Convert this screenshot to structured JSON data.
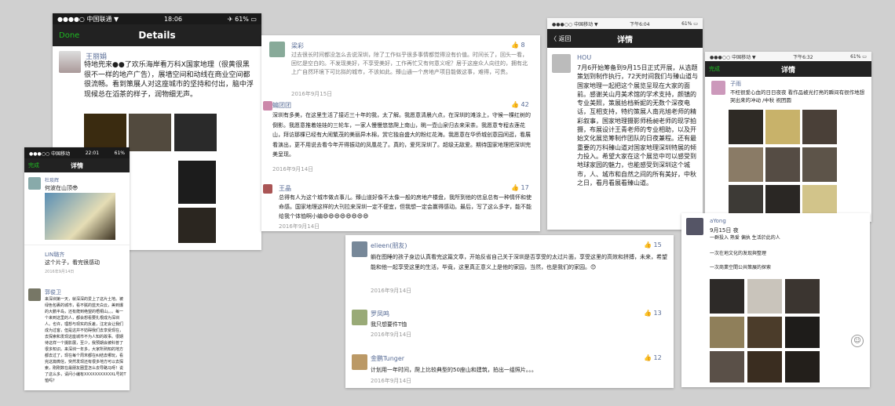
{
  "c1": {
    "time": "18:06",
    "carrier": "●●●●○ 中国联通 ▼",
    "battery": "✈ 61% ▭",
    "done": "Done",
    "title": "Details",
    "name": "王丽娟",
    "text": "特地兜来●●了欢乐海岸看万科X国家地理（很黄很黑很不一样的地产广告），展墙空间和动线在商业空间都很流畅。看到策展人对这座城市的坚持和付出，脑中浮现候总在滔茶的样子，润物细无声。"
  },
  "c2": {
    "time": "22:01",
    "carrier": "●●●○○ 中国移动",
    "battery": "61%",
    "done": "完成",
    "title": "详情",
    "name": "杜琰辉",
    "text": "何波在山顶😎",
    "comment1_name": "LIN璐齐",
    "comment1": "这个片子，看完很感动",
    "comment1_time": "2016年9月14日",
    "comment1_likes": "9",
    "comment2_name": "郭俊卫",
    "comment2_likes": "8",
    "comment2": "来深圳第一天，就深深的爱上了这片土地。被绿色包裹的城市，看不腻的蓝天白云，美到爆的大鹏半岛，还有爬到绝望的梧桐山。。。每一个来到这里的人，都会想看要扎根成为深圳人。也许，理想与现实的反差，注定会让我们成为过客，但是这并不妨碍我们去享受现在，去探索和发现这座城市不为人知的故事。很期待这样一个摄影展，至少，我预期会被科普了很多知识。来深圳一年多，大家所熟知的地方都去过了，现在每个周末都在纠结去哪玩，看完这篇微信，突然发现还有很多地方可以去探索，刚刚数在最朋友圈里怎么去导路马呀！说了这么多，请问小编有XXXXXXXXXXXL号的T恤吗？",
    "comment2_time": "2016年9月16日"
  },
  "c3": {
    "c1_name": "梁彩",
    "c1_likes": "8",
    "c1": "过去很长时间都没怎么去说深圳，除了工作似乎很多事情都觉得没有价值。时间长了，回头一看，回忆是空白的。不发现美好，不享受美好，工作再忙又有何意义呢？居于这座众人向往的，拥有北上广自然环境下可比拟的城市，不该如此。臻山通一个房地产项目能做这事，难得，可贵。",
    "c1_time": "2016年9月15日",
    "c2_name": "蝙团团",
    "c2_likes": "42",
    "c2": "深圳有多美，在这里生活了接近三十年的我，太了解。我愿意清晨六点，在深圳的滩涂上，守候一棵红树的倒影。我愿意推着娃娃的三轮车，一家人慢慢悠悠爬上南山，眺一壶山泉归去来采茶。我愿意专程去莲花山，拜访那棵已经有大闹繁茂的美丽异木棉，赏它独自盛大的粉红花海。我愿意在华侨城创意园闲逛，看展看演出，更不用说去看今年开得振动的凤凰花了。真的，爱死深圳了。超级无敌爱。期待国家地理把深圳完美呈现。",
    "c2_time": "2016年9月14日",
    "c3_name": "王晶",
    "c3_likes": "17",
    "c3": "总得有人为这个城市做点事儿。臻山道好像不太像一般的房地产楼盘，我所到他的信息总有一种情怀和使命感。国家地理这样的大刊拉来深圳一定不便宜，但我想一定会赢得感动。最后，写了这么多字，能不能给我个体恤啊小编😄😄😄😄😄😄😄😄",
    "c3_time": "2016年9月14日"
  },
  "c4": {
    "c1_name": "elieen(朋友)",
    "c1_likes": "15",
    "c1": "躺在图睡的孩子身边认真看完这篇文章，开始反省自己关于深圳是否享受的太过片面，享受这里的高效和拼搏，未来，希望能和他一起享受这里的生活，毕竟，这里真正意义上是他的家园，当然，也是我们的家园。😊",
    "c1_time": "2016年9月14日",
    "c2_name": "罗凤鸣",
    "c2_likes": "13",
    "c2": "我只想要件T恤",
    "c2_time": "2016年9月14日",
    "c3_name": "金鹏Tunger",
    "c3_likes": "12",
    "c3": "计划用一年时间，爬上比较典型的50座山和建筑，拍出一组照片。。。",
    "c3_time": "2016年9月14日"
  },
  "c5": {
    "time": "下午6:04",
    "carrier": "●●●○○ 中国移动 ▼",
    "battery": "61% ▭",
    "back": "〈 返回",
    "title": "详情",
    "name": "HOU",
    "text": "7月6开始筹备到9月15日正式开展，从选题策划到制作执行，72天时间我们与臻山道与国家地理一起把这个展览呈现在大家的面前。感谢关山月美术馆的学术支持，颜镇的专业美照，策展拾档新妮的无数个深夜电话，互相支持，特约策展人南兆旭老师的精彩叙事，国家地理摄影师杨昶老师的现学拍摄，布展设计王青老师的专业相助，以及开始文化展览筹制作团队的日夜兼程。还有最重要的万科臻山道对国家地理深圳特展的倾力投入。希望大家在这个展览中可以感受到地球家园的魅力，也能感受到深圳这个城市，人、城市和自然之间的所有美好，中秋之日，看月看展看臻山道。"
  },
  "c6": {
    "time": "下午6:32",
    "carrier": "●●●○○ 中国移动 ▼",
    "battery": "61% ▭",
    "done": "完成",
    "title": "详情",
    "name": "子雨",
    "text": "不枉很爱心血的日日夜夜 看作品被光打亮的瞬间有很作地想哭出来的冲动 /中秋 祝团圆"
  },
  "c7": {
    "name": "aYong",
    "date": "9月15日 夜",
    "t1": "一群投入 熟爱 偏执 生活於此的人",
    "t2": "一次在地文化的发现與整理",
    "t3": "一次商業空間公共策展的探索"
  }
}
